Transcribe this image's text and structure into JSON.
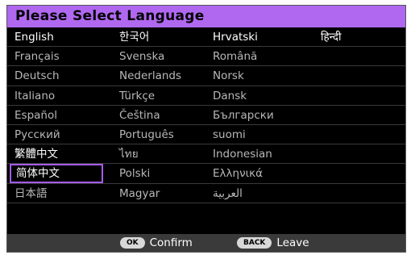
{
  "header": {
    "title": "Please Select Language"
  },
  "languages": {
    "rows": [
      [
        "English",
        "한국어",
        "Hrvatski",
        "हिन्दी"
      ],
      [
        "Français",
        "Svenska",
        "Română",
        ""
      ],
      [
        "Deutsch",
        "Nederlands",
        "Norsk",
        ""
      ],
      [
        "Italiano",
        "Türkçe",
        "Dansk",
        ""
      ],
      [
        "Español",
        "Čeština",
        "Български",
        ""
      ],
      [
        "Русский",
        "Português",
        "suomi",
        ""
      ],
      [
        "繁體中文",
        "ไทย",
        "Indonesian",
        ""
      ],
      [
        "简体中文",
        "Polski",
        "Ελληνικά",
        ""
      ],
      [
        "日本語",
        "Magyar",
        "العربية",
        ""
      ]
    ],
    "selected": "简体中文"
  },
  "footer": {
    "ok_key": "OK",
    "ok_label": "Confirm",
    "back_key": "BACK",
    "back_label": "Leave"
  },
  "colors": {
    "accent": "#b068f0",
    "selection_border": "#a45ce8",
    "background": "#000000",
    "footer": "#3a3a3a"
  }
}
